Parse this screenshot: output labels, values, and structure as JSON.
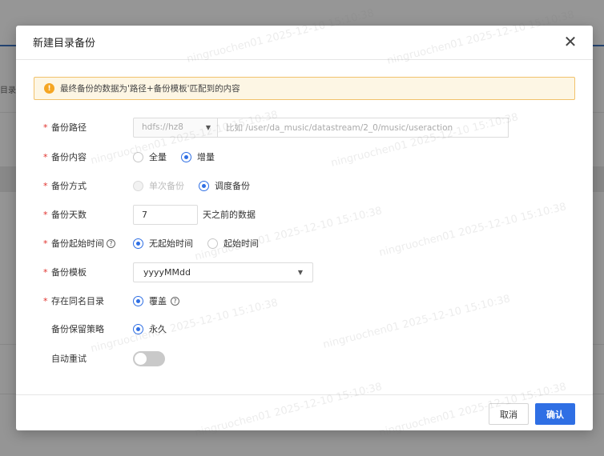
{
  "background": {
    "side_label": "目录"
  },
  "dialog": {
    "title": "新建目录备份",
    "close_glyph": "✕"
  },
  "alert": {
    "icon_glyph": "!",
    "text": "最终备份的数据为'路径+备份模板'匹配到的内容"
  },
  "form": {
    "path": {
      "required": "*",
      "label": "备份路径",
      "cluster_value": "hdfs://hz8",
      "path_placeholder": "比如 /user/da_music/datastream/2_0/music/useraction"
    },
    "content": {
      "required": "*",
      "label": "备份内容",
      "options": [
        {
          "label": "全量",
          "checked": false
        },
        {
          "label": "增量",
          "checked": true
        }
      ]
    },
    "mode": {
      "required": "*",
      "label": "备份方式",
      "options": [
        {
          "label": "单次备份",
          "checked": false,
          "disabled": true
        },
        {
          "label": "调度备份",
          "checked": true,
          "disabled": false
        }
      ]
    },
    "days": {
      "required": "*",
      "label": "备份天数",
      "value": "7",
      "suffix": "天之前的数据"
    },
    "start_time": {
      "required": "*",
      "label": "备份起始时间",
      "help_glyph": "?",
      "options": [
        {
          "label": "无起始时间",
          "checked": true
        },
        {
          "label": "起始时间",
          "checked": false
        }
      ]
    },
    "template": {
      "required": "*",
      "label": "备份模板",
      "value": "yyyyMMdd"
    },
    "same_name": {
      "required": "*",
      "label": "存在同名目录",
      "help_glyph": "?",
      "options": [
        {
          "label": "覆盖",
          "checked": true
        }
      ]
    },
    "retention": {
      "label": "备份保留策略",
      "options": [
        {
          "label": "永久",
          "checked": true
        }
      ]
    },
    "auto_retry": {
      "label": "自动重试",
      "enabled": false
    }
  },
  "footer": {
    "cancel_label": "取消",
    "ok_label": "确认"
  },
  "watermark": {
    "text": "ningruochen01 2025-12-10 15:10:38"
  },
  "colors": {
    "primary": "#2f6fe4",
    "required": "#e0312c",
    "warning": "#f5a623",
    "alert_bg": "#fdf6e4",
    "alert_border": "#f1c26b"
  },
  "icons": {
    "close": "close-icon",
    "warning": "warning-icon",
    "help": "help-circle-icon",
    "caret": "caret-down-icon"
  }
}
